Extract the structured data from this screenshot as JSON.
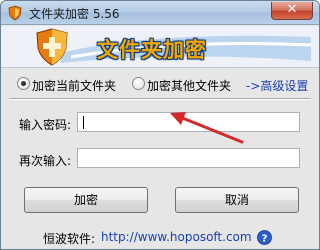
{
  "window": {
    "title": "文件夹加密 5.56",
    "close_glyph": "✕"
  },
  "banner": {
    "title": "文件夹加密"
  },
  "options": [
    {
      "label": "加密当前文件夹",
      "selected": true
    },
    {
      "label": "加密其他文件夹",
      "selected": false
    }
  ],
  "advanced_link": "->高级设置",
  "form": {
    "password_label": "输入密码:",
    "password_value": "",
    "confirm_label": "再次输入:",
    "confirm_value": ""
  },
  "buttons": {
    "encrypt": "加密",
    "cancel": "取消"
  },
  "footer": {
    "company": "恒波软件:",
    "url": "http://www.hoposoft.com"
  },
  "colors": {
    "banner_title": "#f2a600",
    "banner_outline": "#0a3c88",
    "arrow": "#d42a2a",
    "link": "#1a3fb0"
  },
  "icons": {
    "app": "shield-icon",
    "banner": "shield-icon",
    "close": "close-icon",
    "help": "help-icon",
    "annotation": "arrow-icon"
  }
}
